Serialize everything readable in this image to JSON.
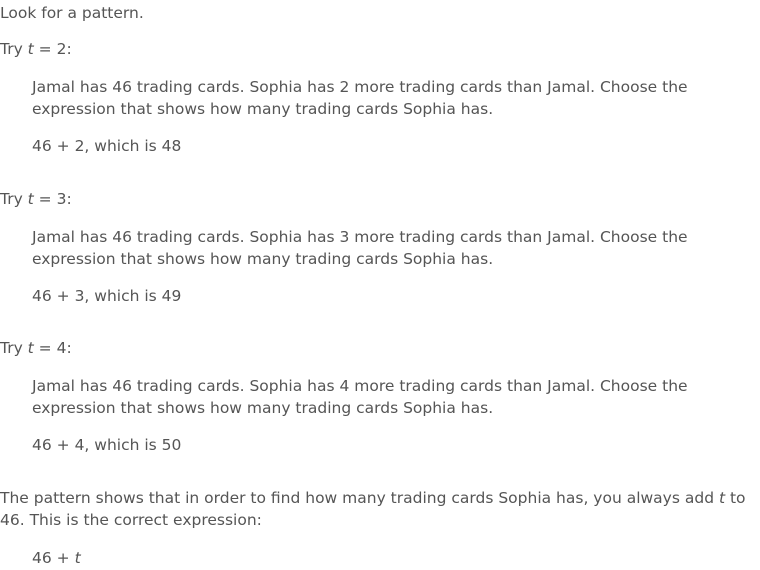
{
  "intro": "Look for a pattern.",
  "trials": [
    {
      "try_prefix": "Try ",
      "var": "t",
      "try_suffix": " = 2:",
      "problem": "Jamal has 46 trading cards. Sophia has 2 more trading cards than Jamal. Choose the expression that shows how many trading cards Sophia has.",
      "result": "46 + 2, which is 48"
    },
    {
      "try_prefix": "Try ",
      "var": "t",
      "try_suffix": " = 3:",
      "problem": "Jamal has 46 trading cards. Sophia has 3 more trading cards than Jamal. Choose the expression that shows how many trading cards Sophia has.",
      "result": "46 + 3, which is 49"
    },
    {
      "try_prefix": "Try ",
      "var": "t",
      "try_suffix": " = 4:",
      "problem": "Jamal has 46 trading cards. Sophia has 4 more trading cards than Jamal. Choose the expression that shows how many trading cards Sophia has.",
      "result": "46 + 4, which is 50"
    }
  ],
  "conclusion": {
    "text_before_var": "The pattern shows that in order to find how many trading cards Sophia has, you always add ",
    "var": "t",
    "text_after_var": " to 46. This is the correct expression:",
    "answer_prefix": "46 + ",
    "answer_var": "t"
  }
}
